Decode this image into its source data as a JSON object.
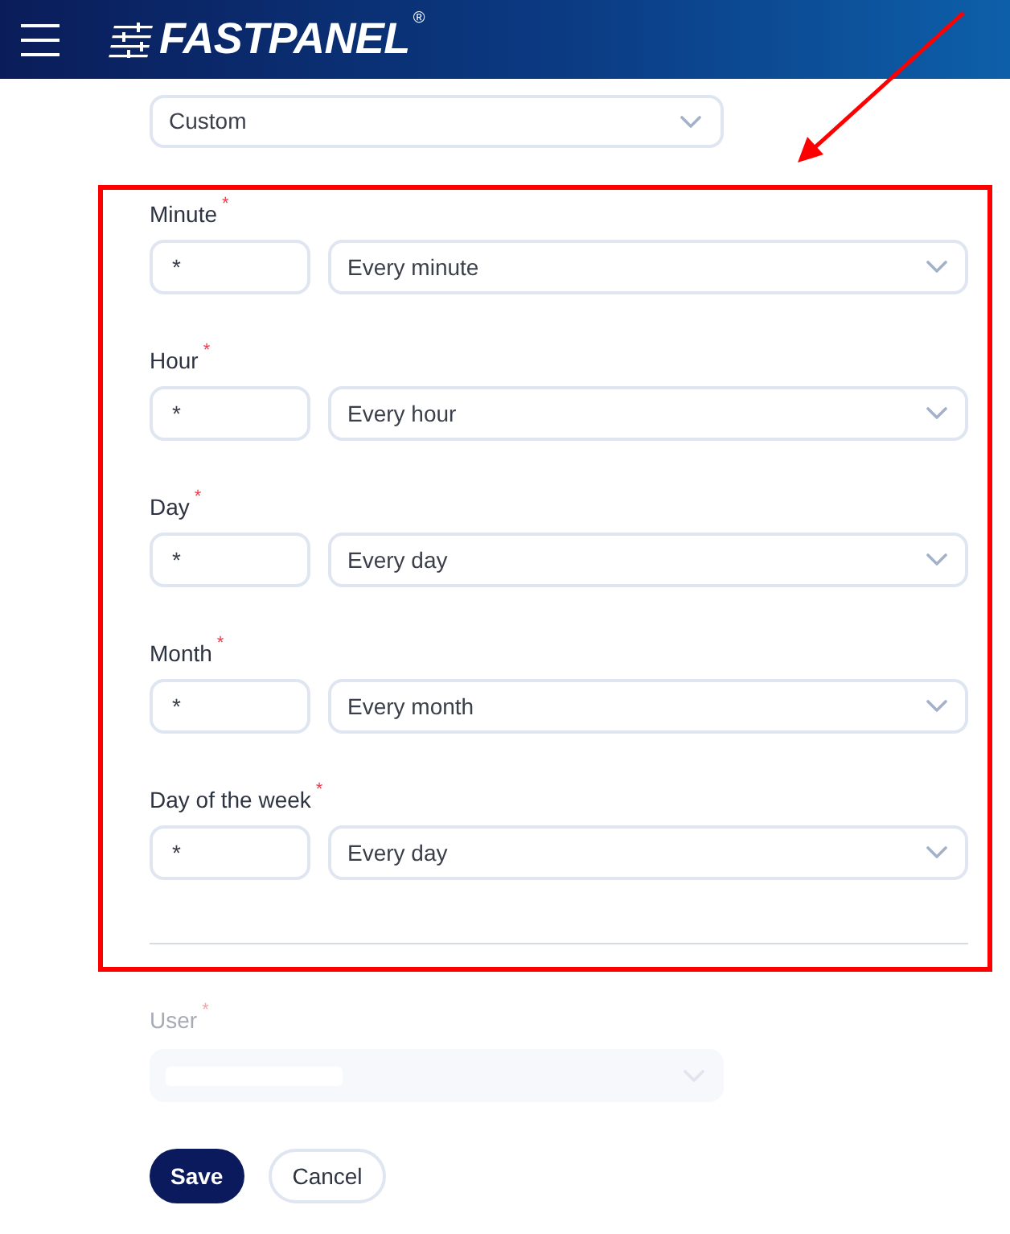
{
  "header": {
    "logo": "FASTPANEL$^{®}$"
  },
  "schedule_select": {
    "value": "Custom"
  },
  "fields": [
    {
      "label": "Minute",
      "required_mark": "*",
      "value": "*",
      "option": "Every minute"
    },
    {
      "label": "Hour",
      "required_mark": "*",
      "value": "*",
      "option": "Every hour"
    },
    {
      "label": "Day",
      "required_mark": "*",
      "value": "*",
      "option": "Every day"
    },
    {
      "label": "Month",
      "required_mark": "*",
      "value": "*",
      "option": "Every month"
    },
    {
      "label": "Day of the week",
      "required_mark": "*",
      "value": "*",
      "option": "Every day"
    }
  ],
  "user": {
    "label": "User",
    "required_mark": "*",
    "disabled": true
  },
  "buttons": [
    {
      "label": "Save",
      "kind": "primary"
    },
    {
      "label": "Cancel",
      "kind": "secondary"
    }
  ]
}
